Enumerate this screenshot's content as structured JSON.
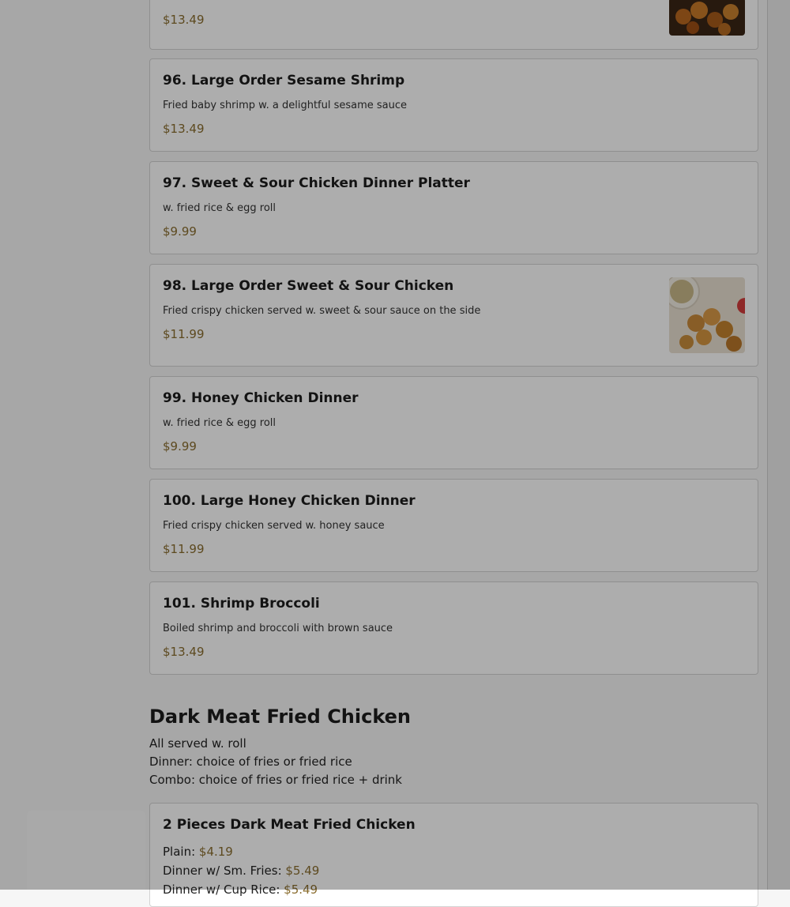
{
  "menu": {
    "top_partial": {
      "price": "$13.49"
    },
    "items": [
      {
        "name": "96. Large Order Sesame Shrimp",
        "desc": "Fried baby shrimp w. a delightful sesame sauce",
        "price": "$13.49"
      },
      {
        "name": "97. Sweet & Sour Chicken Dinner Platter",
        "desc": "w. fried rice & egg roll",
        "price": "$9.99"
      },
      {
        "name": "98. Large Order Sweet & Sour Chicken",
        "desc": "Fried crispy chicken served w. sweet & sour sauce on the side",
        "price": "$11.99"
      },
      {
        "name": "99. Honey Chicken Dinner",
        "desc": "w. fried rice & egg roll",
        "price": "$9.99"
      },
      {
        "name": "100. Large Honey Chicken Dinner",
        "desc": "Fried crispy chicken served w. honey sauce",
        "price": "$11.99"
      },
      {
        "name": "101. Shrimp Broccoli",
        "desc": "Boiled shrimp and broccoli with brown sauce",
        "price": "$13.49"
      }
    ],
    "section": {
      "title": "Dark Meat Fried Chicken",
      "notes": [
        "All served w. roll",
        "Dinner: choice of fries or fried rice",
        "Combo: choice of fries or fried rice + drink"
      ]
    },
    "section_item": {
      "name": "2 Pieces Dark Meat Fried Chicken",
      "options": [
        {
          "label": "Plain: ",
          "price": "$4.19"
        },
        {
          "label": "Dinner w/ Sm. Fries: ",
          "price": "$5.49"
        },
        {
          "label": "Dinner w/ Cup Rice: ",
          "price": "$5.49"
        }
      ]
    }
  },
  "images": [
    "fried-chicken-photo",
    "sweet-sour-chicken-photo"
  ],
  "colors": {
    "price": "#8a6d2f",
    "overlay": "rgba(0,0,0,0.32)"
  }
}
